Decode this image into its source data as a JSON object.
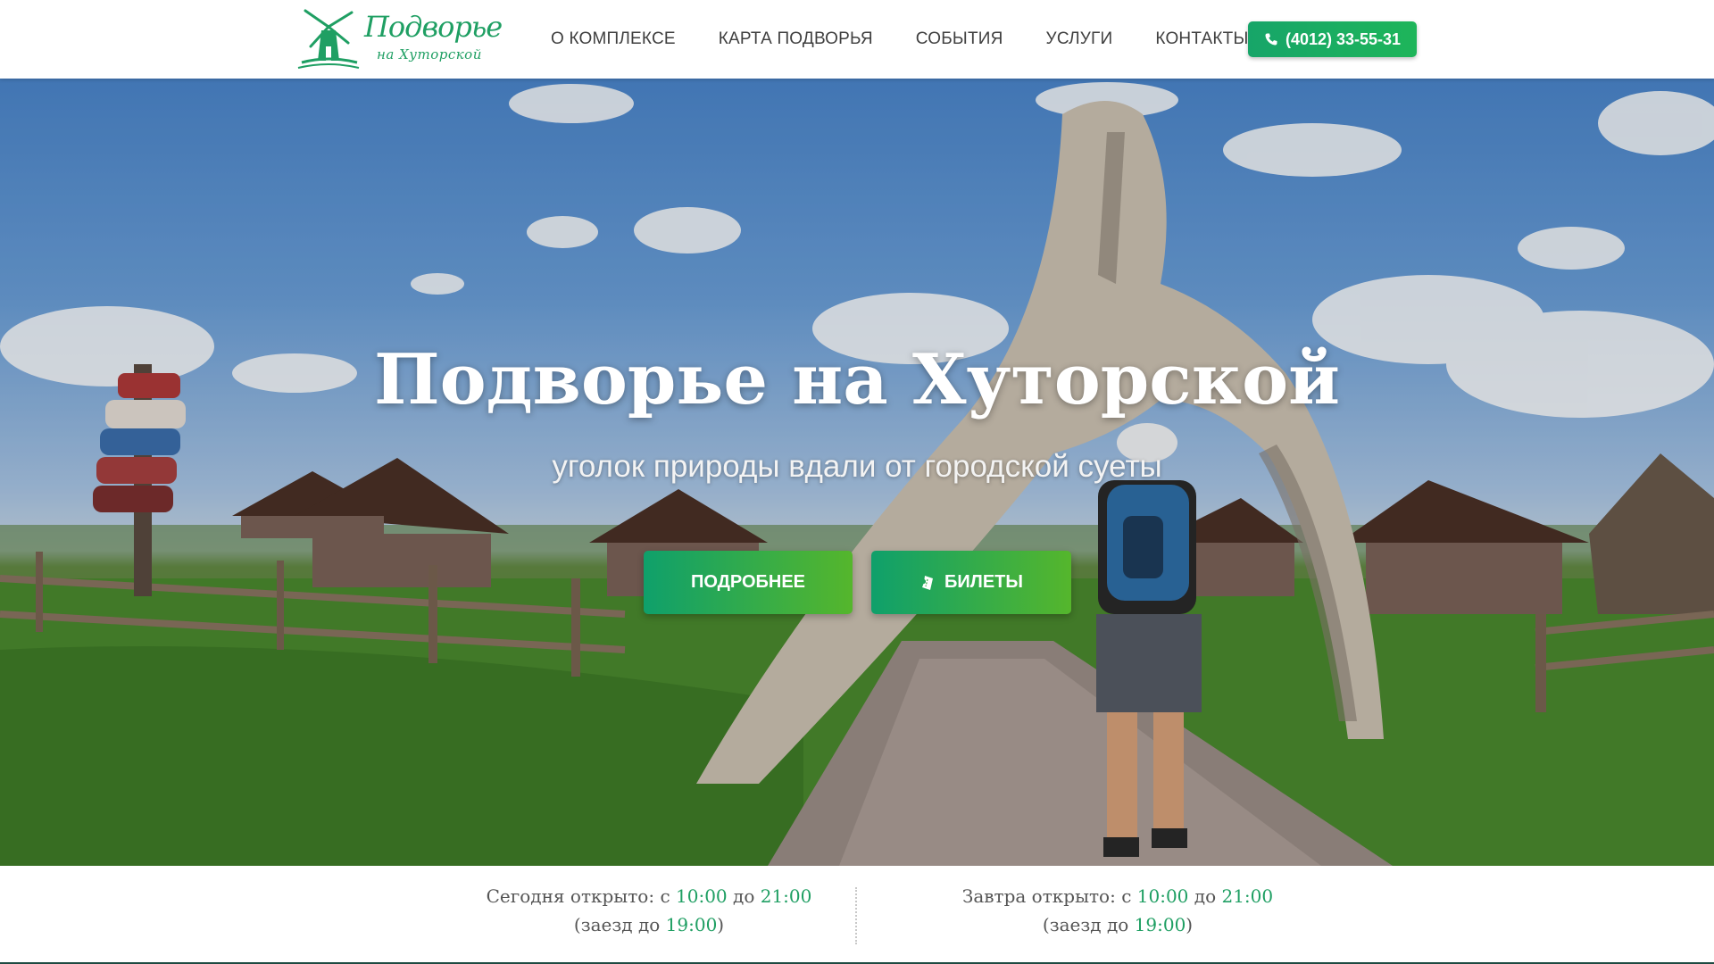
{
  "header": {
    "logo": {
      "title": "Подворье",
      "subtitle": "на Хуторской",
      "icon": "windmill-icon"
    },
    "nav": [
      {
        "label": "О комплексе"
      },
      {
        "label": "Карта подворья"
      },
      {
        "label": "События"
      },
      {
        "label": "Услуги"
      },
      {
        "label": "Контакты"
      }
    ],
    "phone": {
      "label": "(4012) 33-55-31",
      "icon": "phone-icon"
    }
  },
  "hero": {
    "title": "Подворье на Хуторской",
    "subtitle": "уголок природы вдали от городской суеты",
    "buttons": {
      "more": {
        "label": "Подробнее"
      },
      "tickets": {
        "label": "Билеты",
        "icon": "ticket-icon"
      }
    }
  },
  "hours": {
    "today": {
      "label": "Сегодня открыто:",
      "from_word": "с",
      "open": "10:00",
      "to_word": "до",
      "close": "21:00",
      "checkin_prefix": "(заезд до",
      "checkin": "19:00",
      "checkin_suffix": ")"
    },
    "tomorrow": {
      "label": "Завтра открыто:",
      "from_word": "с",
      "open": "10:00",
      "to_word": "до",
      "close": "21:00",
      "checkin_prefix": "(заезд до",
      "checkin": "19:00",
      "checkin_suffix": ")"
    }
  },
  "colors": {
    "brand_green": "#1f9f63",
    "button_gradient_start": "#0fa06b",
    "button_gradient_end": "#55b62c",
    "nav_text": "#3f3f3f"
  }
}
